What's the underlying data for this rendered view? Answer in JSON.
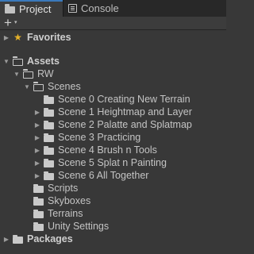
{
  "tabs": [
    {
      "label": "Project",
      "icon": "folder-icon",
      "active": true
    },
    {
      "label": "Console",
      "icon": "console-icon",
      "active": false
    }
  ],
  "toolbar": {
    "create_label": "+",
    "create_caret": "▾"
  },
  "tree": {
    "favorites": "Favorites",
    "assets": "Assets",
    "rw": "RW",
    "scenes": "Scenes",
    "scene_items": [
      "Scene 0 Creating New Terrain",
      "Scene 1 Heightmap and Layer",
      "Scene 2 Palatte and Splatmap",
      "Scene 3 Practicing",
      "Scene 4 Brush n Tools",
      "Scene 5 Splat n Painting",
      "Scene 6 All Together"
    ],
    "rw_folders": [
      "Scripts",
      "Skyboxes",
      "Terrains",
      "Unity Settings"
    ],
    "packages": "Packages"
  },
  "arrows": {
    "collapsed": "▶",
    "expanded": "▼"
  }
}
